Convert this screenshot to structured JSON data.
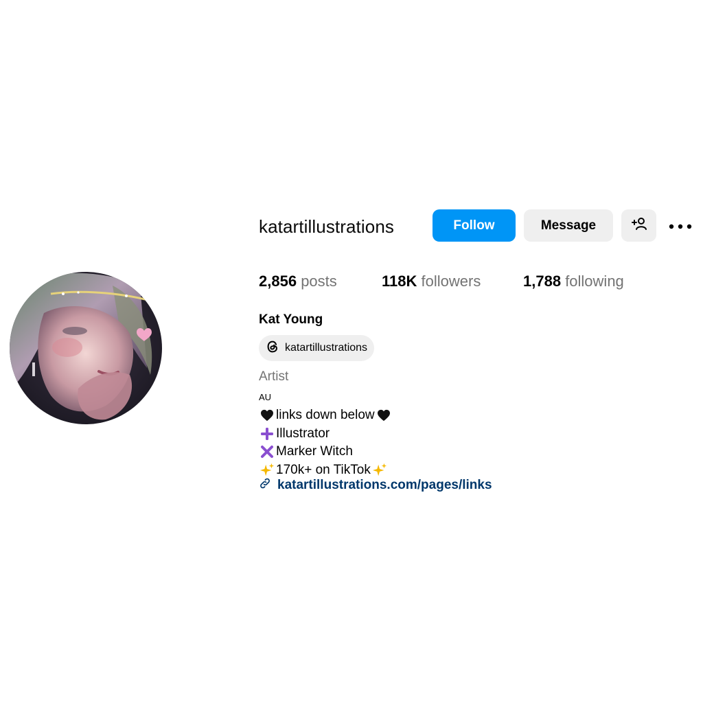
{
  "profile": {
    "username": "katartillustrations",
    "full_name": "Kat Young",
    "threads_handle": "katartillustrations",
    "category": "Artist",
    "location": "AU"
  },
  "actions": {
    "follow_label": "Follow",
    "message_label": "Message"
  },
  "stats": {
    "posts_count": "2,856",
    "posts_label": "posts",
    "followers_count": "118K",
    "followers_label": "followers",
    "following_count": "1,788",
    "following_label": "following"
  },
  "bio": {
    "lines": [
      {
        "emoji": "black-heart-icon",
        "text": "links down below",
        "trailing_emoji": "black-heart-icon"
      },
      {
        "emoji": "purple-plus-icon",
        "text": "Illustrator"
      },
      {
        "emoji": "purple-cross-icon",
        "text": "Marker Witch"
      },
      {
        "emoji": "sparkles-icon",
        "text": "170k+ on TikTok",
        "trailing_emoji": "sparkles-icon"
      }
    ],
    "link_text": "katartillustrations.com/pages/links"
  },
  "colors": {
    "follow_button": "#0095f6",
    "secondary_button": "#efefef",
    "muted_text": "#737373",
    "link_text": "#00376b"
  }
}
